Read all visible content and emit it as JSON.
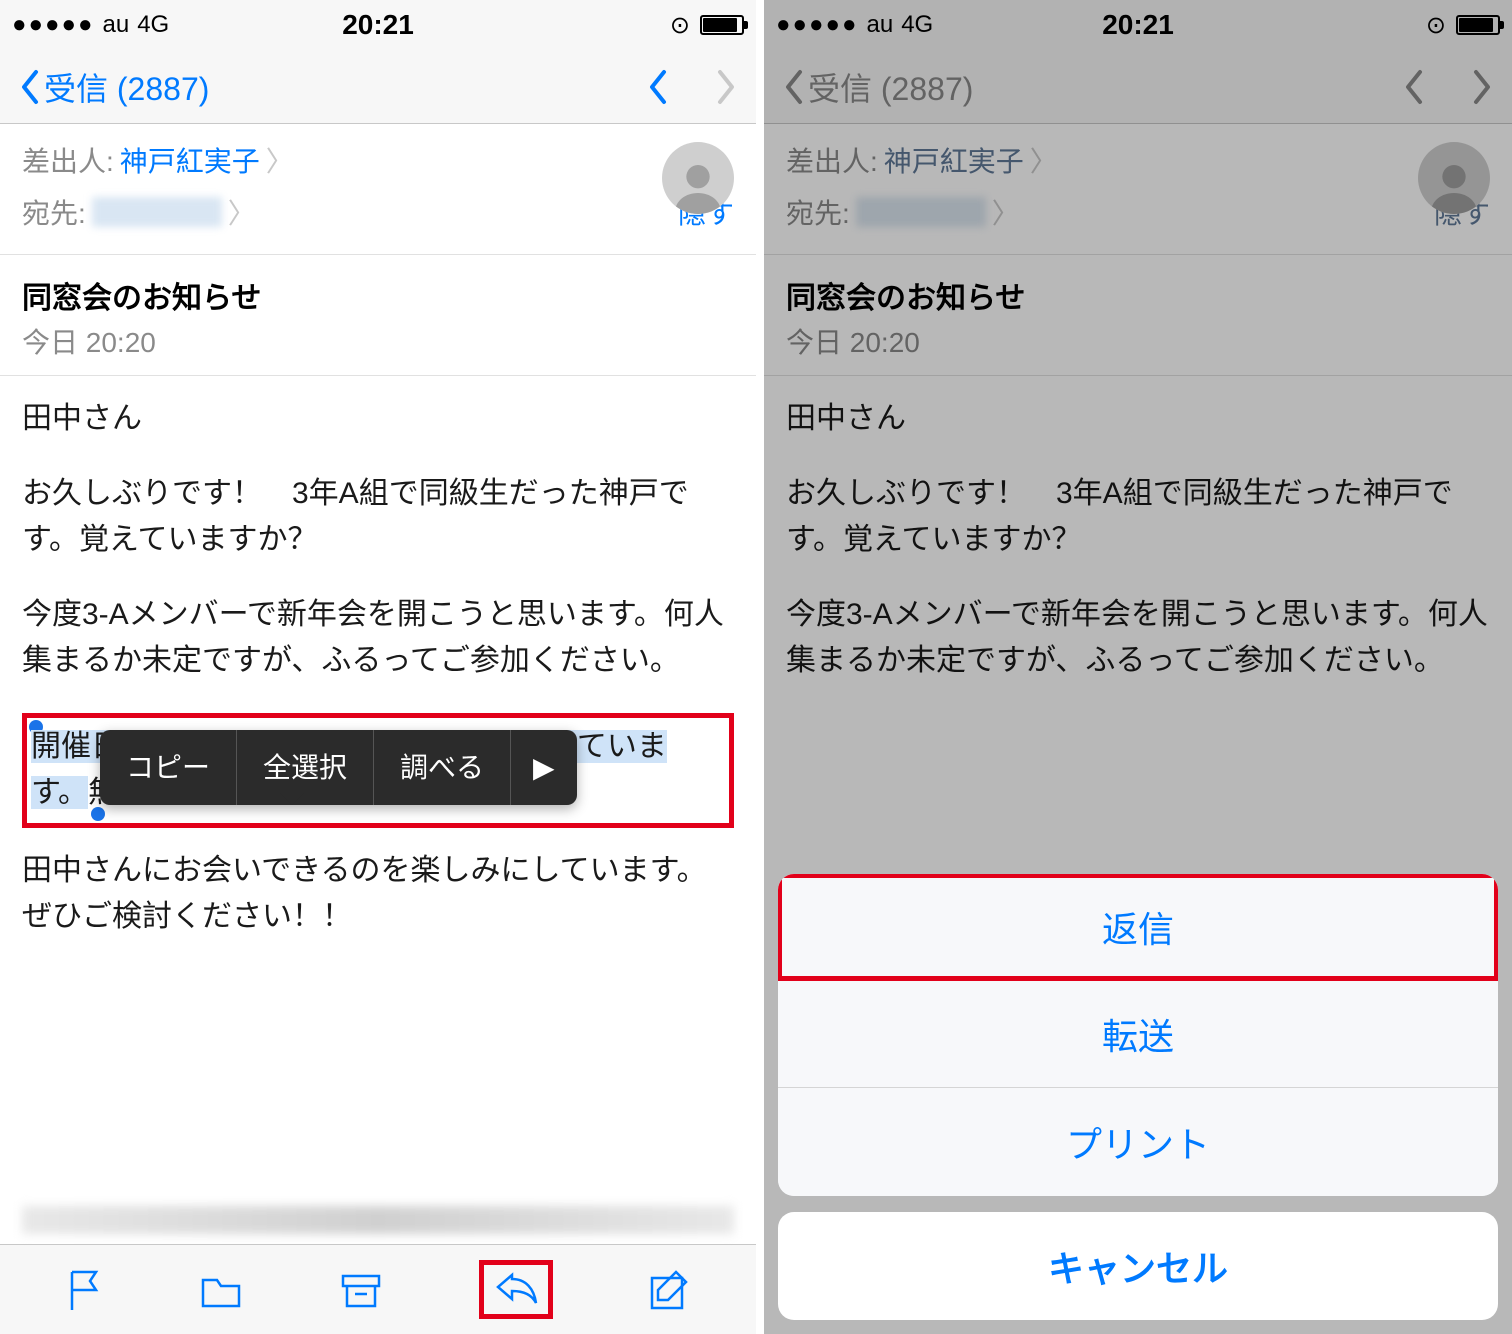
{
  "status": {
    "carrier": "au",
    "network": "4G",
    "time": "20:21"
  },
  "nav": {
    "back_label": "受信 (2887)"
  },
  "meta": {
    "from_label": "差出人:",
    "from_value": "神戸紅実子",
    "to_label": "宛先:",
    "hide_label": "隠す"
  },
  "subject": {
    "title": "同窓会のお知らせ",
    "date": "今日 20:20"
  },
  "body": {
    "p1": "田中さん",
    "p2": "お久しぶりです！　3年A組で同級生だった神戸です。覚えていますか？",
    "p3": "今度3-Aメンバーで新年会を開こうと思います。何人集まるか未定ですが、ふるってご参加ください。",
    "sel1": "開催日は1月5日（木）の19時〜を予定していま",
    "sel2": "す。",
    "sel_rest": "無理だったら教えてくださいね。",
    "p5": "田中さんにお会いできるのを楽しみにしています。ぜひご検討ください！！"
  },
  "popup": {
    "copy": "コピー",
    "select_all": "全選択",
    "lookup": "調べる",
    "more": "▶"
  },
  "sheet": {
    "reply": "返信",
    "forward": "転送",
    "print": "プリント",
    "cancel": "キャンセル"
  }
}
